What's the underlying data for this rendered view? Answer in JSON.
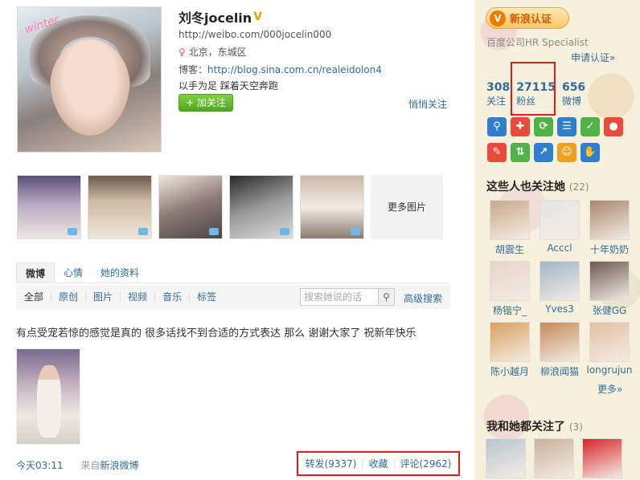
{
  "profile": {
    "name": "刘冬jocelin",
    "verified_mark": "V",
    "url": "http://weibo.com/000jocelin000",
    "location": "北京，东城区",
    "blog_label": "博客：",
    "blog_url": "http://blog.sina.com.cn/realeidolon4",
    "bio": "以手为足 踩着天空奔跑",
    "follow_label": "+ 加关注",
    "quiet_follow": "悄悄关注",
    "avatar_tag": "winter"
  },
  "photos": {
    "more_label": "更多图片"
  },
  "tabs": [
    "微博",
    "心情",
    "她的资料"
  ],
  "filters": [
    "全部",
    "原创",
    "图片",
    "视频",
    "音乐",
    "标签"
  ],
  "search": {
    "placeholder": "搜索她说的话",
    "advanced": "高级搜索"
  },
  "post": {
    "text": "有点受宠若惊的感觉是真的 很多话找不到合适的方式表达 那么 谢谢大家了 祝新年快乐",
    "time": "今天03:11",
    "source_prefix": "来自",
    "source": "新浪微博",
    "repost": "转发(9337)",
    "favorite": "收藏",
    "comment": "评论(2962)"
  },
  "sidebar": {
    "verify_label": "新浪认证",
    "company": "百度公司HR Specialist",
    "apply": "申请认证»",
    "stats": [
      {
        "num": "308",
        "label": "关注"
      },
      {
        "num": "27115",
        "label": "粉丝"
      },
      {
        "num": "656",
        "label": "微博"
      }
    ],
    "tool_colors": [
      "#2f7fd1",
      "#e84a3c",
      "#4fb34a",
      "#2f7fd1",
      "#4fb34a",
      "#e84a3c",
      "#e84a3c",
      "#4fb34a",
      "#2f7fd1",
      "#f0a020",
      "#2f7fd1"
    ],
    "tool_icons": [
      "search-icon",
      "gift-icon",
      "refresh-icon",
      "list-icon",
      "like-icon",
      "mic-icon",
      "text-icon",
      "share-icon",
      "repost-icon",
      "smile-icon",
      "hand-icon"
    ],
    "tool_glyphs": [
      "⚲",
      "✚",
      "⟳",
      "☰",
      "✓",
      "●",
      "✎",
      "⇅",
      "↗",
      "☺",
      "✋"
    ],
    "also_follow_title": "这些人也关注她",
    "also_follow_count": "(22)",
    "friends": [
      {
        "name": "胡震生",
        "color": "#c9a98a"
      },
      {
        "name": "Acccl",
        "color": "#e5e5e5"
      },
      {
        "name": "十年奶奶",
        "color": "#a9876c"
      },
      {
        "name": "杨锴宁_",
        "color": "#e8d4c8"
      },
      {
        "name": "Yves3",
        "color": "#9fb7c8"
      },
      {
        "name": "张健GG",
        "color": "#6b5a50"
      },
      {
        "name": "陈小越月",
        "color": "#d9a15c"
      },
      {
        "name": "柳浪闻猫",
        "color": "#c58a5a"
      },
      {
        "name": "longrujun",
        "color": "#e2c0a0"
      }
    ],
    "more": "更多»",
    "common_title": "我和她都关注了",
    "common_count": "(3)",
    "common_colors": [
      "#b8c6cf",
      "#c9b29a",
      "#d9252a"
    ]
  }
}
